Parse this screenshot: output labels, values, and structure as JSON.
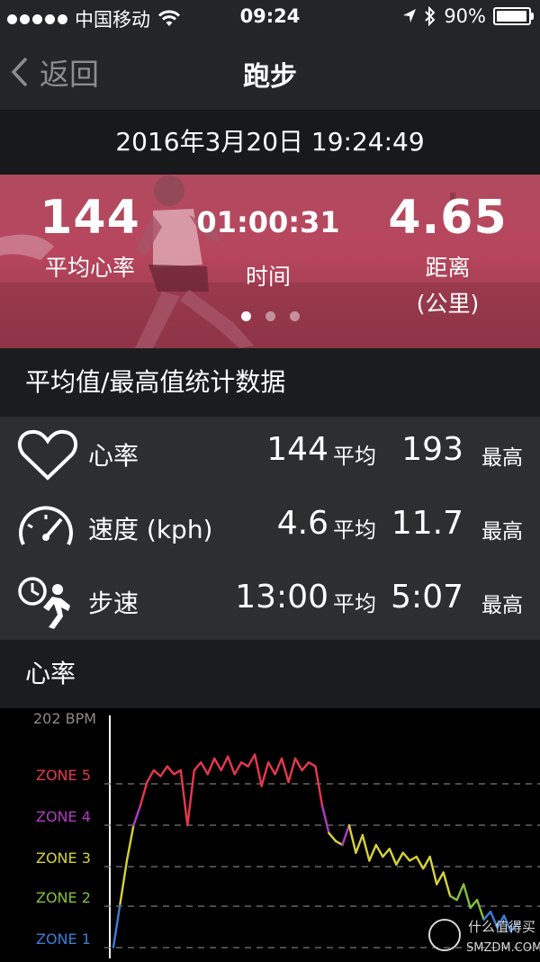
{
  "status_bar": {
    "carrier": "中国移动",
    "time": "09:24",
    "battery": "90%",
    "battery_level": 0.9
  },
  "nav": {
    "back_label": "返回",
    "title": "跑步"
  },
  "session": {
    "datetime": "2016年3月20日 19:24:49"
  },
  "summary": {
    "avg_hr_value": "144",
    "avg_hr_label": "平均心率",
    "time_value": "01:00:31",
    "time_label": "时间",
    "distance_value": "4.65",
    "distance_label": "距离",
    "distance_unit": "(公里)",
    "pages": 3,
    "active_page": 0
  },
  "stats": {
    "title": "平均值/最高值统计数据",
    "rows": [
      {
        "name": "心率",
        "icon": "heart-icon",
        "avg": "144",
        "avg_label": "平均",
        "max": "193",
        "max_label": "最高"
      },
      {
        "name": "速度 (kph)",
        "icon": "speedometer-icon",
        "avg": "4.6",
        "avg_label": "平均",
        "max": "11.7",
        "max_label": "最高"
      },
      {
        "name": "步速",
        "icon": "running-clock-icon",
        "avg": "13:00",
        "avg_label": "平均",
        "max": "5:07",
        "max_label": "最高"
      }
    ]
  },
  "heart_chart": {
    "title": "心率",
    "top_label": "202 BPM"
  },
  "chart_data": {
    "type": "line",
    "title": "心率",
    "ylabel": "202 BPM",
    "zones": [
      {
        "name": "ZONE 5",
        "color": "#e8384f"
      },
      {
        "name": "ZONE 4",
        "color": "#b13bc5"
      },
      {
        "name": "ZONE 3",
        "color": "#d6d23a"
      },
      {
        "name": "ZONE 2",
        "color": "#86c03b"
      },
      {
        "name": "ZONE 1",
        "color": "#3b7ed9"
      }
    ],
    "x": [
      0,
      1,
      2,
      3,
      4,
      5,
      6,
      7,
      8,
      9,
      10,
      11,
      12,
      13,
      14,
      15,
      16,
      17,
      18,
      19,
      20,
      21,
      22,
      23,
      24,
      25,
      26,
      27,
      28,
      29,
      30,
      31,
      32,
      33,
      34,
      35,
      36,
      37,
      38,
      39,
      40,
      41,
      42,
      43,
      44,
      45,
      46,
      47,
      48,
      49,
      50,
      51,
      52,
      53,
      54,
      55,
      56,
      57,
      58,
      59,
      60
    ],
    "y": [
      88,
      110,
      132,
      150,
      160,
      172,
      178,
      175,
      180,
      176,
      178,
      150,
      178,
      182,
      176,
      184,
      178,
      185,
      176,
      182,
      180,
      186,
      170,
      182,
      176,
      184,
      172,
      184,
      178,
      182,
      180,
      160,
      146,
      142,
      140,
      150,
      136,
      145,
      132,
      140,
      134,
      138,
      130,
      136,
      132,
      134,
      128,
      134,
      120,
      126,
      114,
      112,
      120,
      108,
      112,
      102,
      106,
      98,
      104,
      96,
      100
    ],
    "ylim": [
      85,
      205
    ],
    "watermark": [
      "什么值得买",
      "SMZDM.COM"
    ]
  }
}
